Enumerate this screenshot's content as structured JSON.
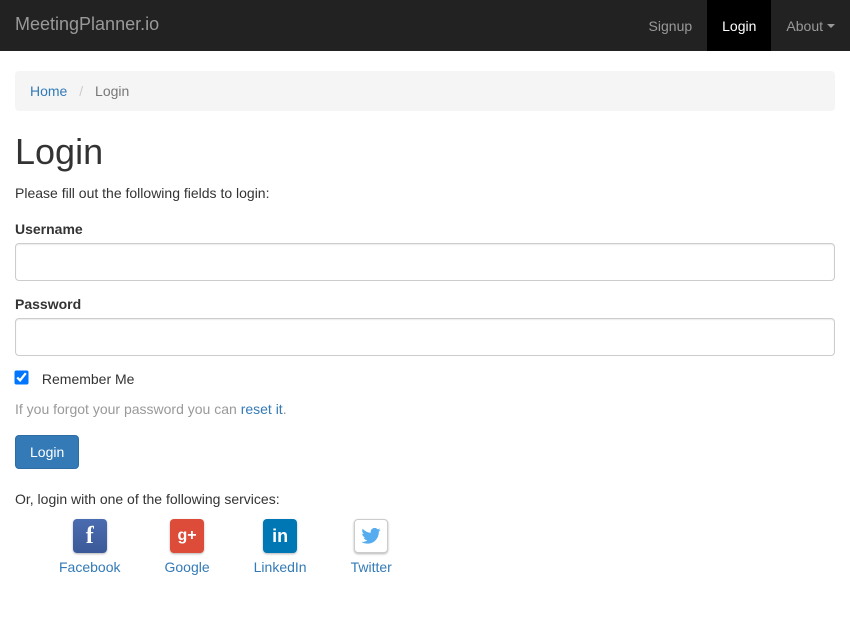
{
  "navbar": {
    "brand": "MeetingPlanner.io",
    "items": [
      {
        "label": "Signup",
        "active": false
      },
      {
        "label": "Login",
        "active": true
      },
      {
        "label": "About",
        "active": false,
        "dropdown": true
      }
    ]
  },
  "breadcrumb": {
    "home": "Home",
    "current": "Login"
  },
  "page": {
    "title": "Login",
    "subtext": "Please fill out the following fields to login:"
  },
  "form": {
    "username_label": "Username",
    "username_value": "",
    "password_label": "Password",
    "password_value": "",
    "remember_label": "Remember Me",
    "remember_checked": true,
    "forgot_prefix": "If you forgot your password you can ",
    "forgot_link": "reset it",
    "forgot_suffix": ".",
    "submit_label": "Login"
  },
  "social": {
    "intro": "Or, login with one of the following services:",
    "providers": [
      {
        "name": "Facebook"
      },
      {
        "name": "Google"
      },
      {
        "name": "LinkedIn"
      },
      {
        "name": "Twitter"
      }
    ]
  }
}
